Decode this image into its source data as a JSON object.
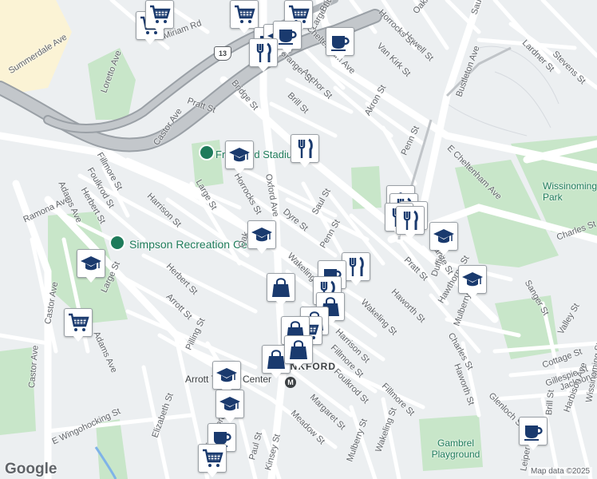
{
  "map": {
    "district_label": "FRANKFORD",
    "google_logo": "Google",
    "attribution": "Map data ©2025",
    "route_shield": "13",
    "colors": {
      "background": "#eceff1",
      "park": "#c8e6c9",
      "highway": "#9aa0a6",
      "marker_icon": "#1a3a6e"
    }
  },
  "pois": {
    "simpson": "Simpson Recreation Center",
    "wissinoming": "Wissinoming Park",
    "gambrel": "Gambrel Playground",
    "stadium": "Frankford Stadium",
    "transit": "Arrott Transit Center"
  },
  "streets": [
    "Summerdale Ave",
    "Loretto Ave",
    "Miriam Rd",
    "Pratt St",
    "Castor Ave",
    "Bridge St",
    "Brill St",
    "Anchor St",
    "Granger St",
    "Large St",
    "Van Kirk St",
    "Howell St",
    "Horrocks St",
    "Oakland St",
    "Saul St",
    "Cheltenham Ave",
    "Lardner St",
    "Stevens St",
    "Bustleton Ave",
    "Akron St",
    "Penn St",
    "E Cheltenham Ave",
    "Fillmore St",
    "Foulkrod St",
    "Herbert St",
    "Adams Ave",
    "Ramona Ave",
    "Harrison St",
    "Large St",
    "Horrocks St",
    "Oxford Ave",
    "Dyre St",
    "Saul St",
    "Charles St",
    "Oak",
    "Wakeling St",
    "Penn St",
    "Granite St",
    "Pratt St",
    "Duffield St",
    "Haworth St",
    "Wakeling St",
    "Hawthorne St",
    "Sanger St",
    "Castor Ave",
    "Herbert St",
    "Arrott St",
    "Large St",
    "Adams Ave",
    "Castor Ave",
    "Harrison St",
    "Fillmore St",
    "Foulkrod St",
    "Mulberry St",
    "Charles St",
    "Valley St",
    "Pilling St",
    "Margaret St",
    "Meadow St",
    "Haworth St",
    "Cottage St",
    "Gillespie St",
    "Jackson St",
    "Fillmore St",
    "Glenloch St",
    "E Wingohocking St",
    "Elizabeth St",
    "Frankford Ave",
    "Paul St",
    "Mulberry St",
    "Kinsey St",
    "Wakeling St",
    "Harbison Ave",
    "Brill St",
    "Leiper St",
    "Bridge St",
    "Wissinoming St"
  ]
}
